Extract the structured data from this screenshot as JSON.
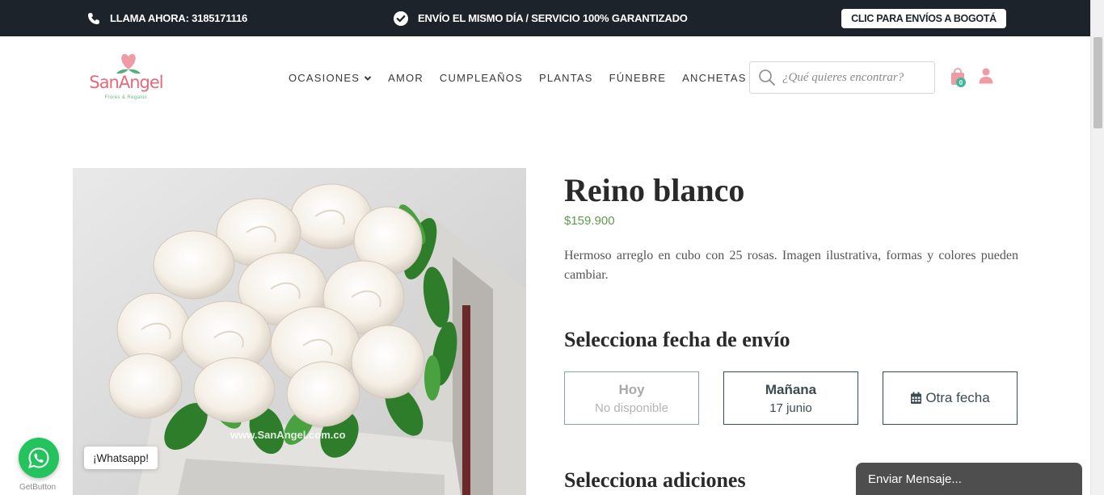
{
  "topbar": {
    "call_text": "LLAMA AHORA: 3185171116",
    "shipping_text": "ENVÍO EL MISMO DÍA / SERVICIO 100% GARANTIZADO",
    "bogota_button": "CLIC PARA ENVÍOS A BOGOTÁ",
    "bg_color": "#1d232b"
  },
  "logo": {
    "brand": "SanAngel",
    "tagline": "Flores & Regalos"
  },
  "nav": {
    "items": [
      "OCASIONES",
      "AMOR",
      "CUMPLEAÑOS",
      "PLANTAS",
      "FÚNEBRE",
      "ANCHETAS"
    ]
  },
  "search": {
    "placeholder": "¿Qué quieres encontrar?"
  },
  "cart": {
    "count": "0"
  },
  "product": {
    "title": "Reino blanco",
    "price": "$159.900",
    "description": "Hermoso arreglo en cubo con 25 rosas. Imagen ilustrativa, formas y colores pueden cambiar.",
    "image_watermark": "www.SanAngel.com.co",
    "price_color": "#5f9a4f"
  },
  "delivery": {
    "title": "Selecciona fecha de envío",
    "options": [
      {
        "main": "Hoy",
        "sub": "No disponible"
      },
      {
        "main": "Mañana",
        "sub": "17 junio"
      },
      {
        "main": "Otra fecha",
        "icon": "calendar-icon"
      }
    ]
  },
  "addons": {
    "title": "Selecciona adiciones"
  },
  "whatsapp": {
    "label": "¡Whatsapp!",
    "provider": "GetButton",
    "color": "#25c35d"
  },
  "chat": {
    "label": "Enviar Mensaje..."
  }
}
